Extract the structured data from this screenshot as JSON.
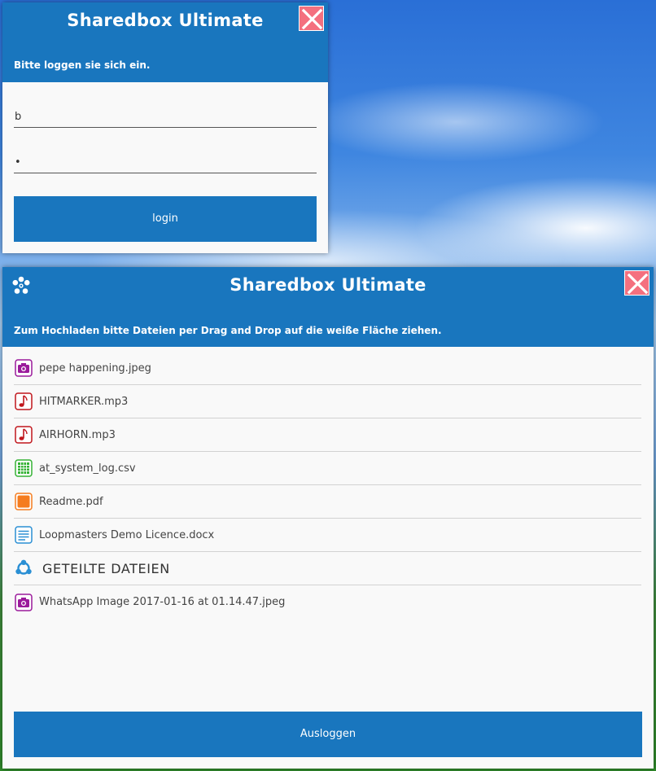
{
  "login_window": {
    "title": "Sharedbox Ultimate",
    "subtitle": "Bitte loggen sie sich ein.",
    "username_value": "b",
    "password_value": "•",
    "login_label": "login"
  },
  "main_window": {
    "title": "Sharedbox Ultimate",
    "subtitle": "Zum Hochladen bitte Dateien per Drag and Drop auf die weiße Fläche ziehen.",
    "files": [
      {
        "name": "pepe happening.jpeg",
        "icon": "camera-icon"
      },
      {
        "name": "HITMARKER.mp3",
        "icon": "music-note-icon"
      },
      {
        "name": "AIRHORN.mp3",
        "icon": "music-note-icon"
      },
      {
        "name": "at_system_log.csv",
        "icon": "spreadsheet-icon"
      },
      {
        "name": "Readme.pdf",
        "icon": "pdf-icon"
      },
      {
        "name": "Loopmasters Demo Licence.docx",
        "icon": "document-icon"
      }
    ],
    "shared_section_label": "GETEILTE DATEIEN",
    "shared_files": [
      {
        "name": "WhatsApp Image 2017-01-16 at 01.14.47.jpeg",
        "icon": "camera-icon"
      }
    ],
    "logout_label": "Ausloggen"
  },
  "colors": {
    "header_blue": "#1976be",
    "close_red": "#f4707f",
    "image_purple": "#9b1a9b",
    "audio_red": "#c0161c",
    "spreadsheet_green": "#35b235",
    "pdf_orange": "#f57c1f",
    "doc_blue": "#2a8fd4",
    "shared_blue": "#2a8fd4"
  }
}
